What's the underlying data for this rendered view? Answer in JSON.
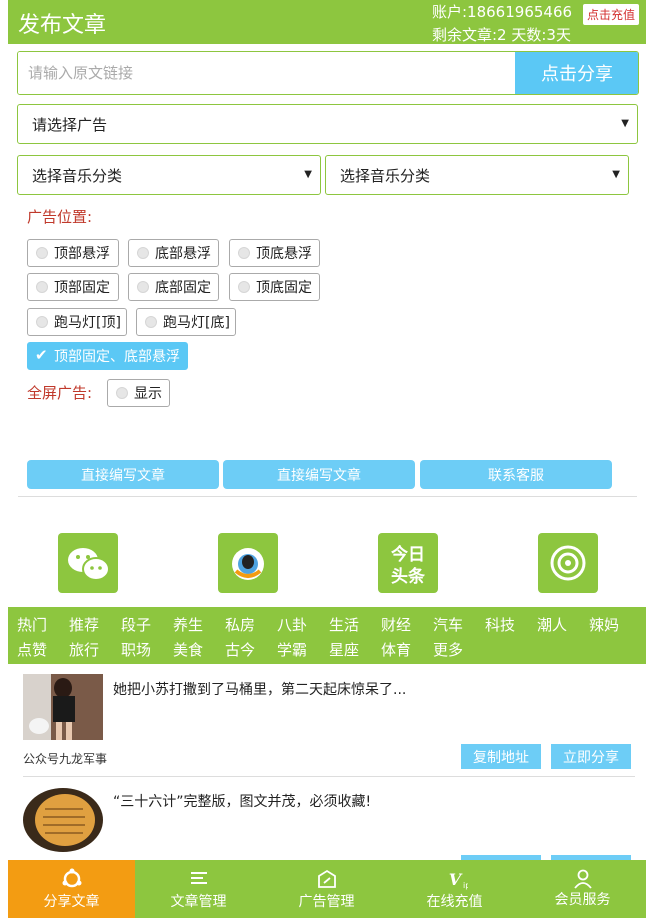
{
  "header": {
    "title": "发布文章",
    "account": "账户:18661965466",
    "remaining": "剩余文章:2  天数:3天",
    "recharge_label": "点击充值"
  },
  "share_row": {
    "placeholder": "请输入原文链接",
    "button_label": "点击分享"
  },
  "selects": {
    "ad": "请选择广告",
    "music_1": "选择音乐分类",
    "music_2": "选择音乐分类"
  },
  "ad_position": {
    "label": "广告位置:",
    "options": [
      {
        "label": "顶部悬浮",
        "checked": false
      },
      {
        "label": "底部悬浮",
        "checked": false
      },
      {
        "label": "顶底悬浮",
        "checked": false
      },
      {
        "label": "顶部固定",
        "checked": false
      },
      {
        "label": "底部固定",
        "checked": false
      },
      {
        "label": "顶底固定",
        "checked": false
      },
      {
        "label": "跑马灯[顶]",
        "checked": false
      },
      {
        "label": "跑马灯[底]",
        "checked": false
      },
      {
        "label": "顶部固定、底部悬浮",
        "checked": true
      }
    ]
  },
  "fullscreen": {
    "label": "全屏广告:",
    "option": "显示"
  },
  "actions": [
    "直接编写文章",
    "直接编写文章",
    "联系客服"
  ],
  "apps": [
    {
      "name": "wechat-icon"
    },
    {
      "name": "qq-icon"
    },
    {
      "name": "toutiao-icon",
      "text": "今日头条"
    },
    {
      "name": "weibo-icon"
    }
  ],
  "categories_row1": [
    "热门",
    "推荐",
    "段子",
    "养生",
    "私房",
    "八卦",
    "生活",
    "财经",
    "汽车",
    "科技",
    "潮人",
    "辣妈"
  ],
  "categories_row2": [
    "点赞",
    "旅行",
    "职场",
    "美食",
    "古今",
    "学霸",
    "星座",
    "体育",
    "更多"
  ],
  "articles": [
    {
      "title": "她把小苏打撒到了马桶里，第二天起床惊呆了...",
      "source": "公众号九龙军事"
    },
    {
      "title": "“三十六计”完整版，图文并茂，必须收藏!",
      "source": ""
    }
  ],
  "article_buttons": {
    "copy": "复制地址",
    "share": "立即分享"
  },
  "bottom_nav": [
    {
      "label": "分享文章",
      "icon": "share-icon",
      "active": true
    },
    {
      "label": "文章管理",
      "icon": "list-icon",
      "active": false
    },
    {
      "label": "广告管理",
      "icon": "ad-icon",
      "active": false
    },
    {
      "label": "在线充值",
      "icon": "vip-icon",
      "active": false
    },
    {
      "label": "会员服务",
      "icon": "user-icon",
      "active": false
    }
  ],
  "colors": {
    "brand_green": "#8dc63f",
    "accent_blue": "#5bc8f5",
    "active_orange": "#f39c12",
    "label_red": "#c0392b"
  }
}
